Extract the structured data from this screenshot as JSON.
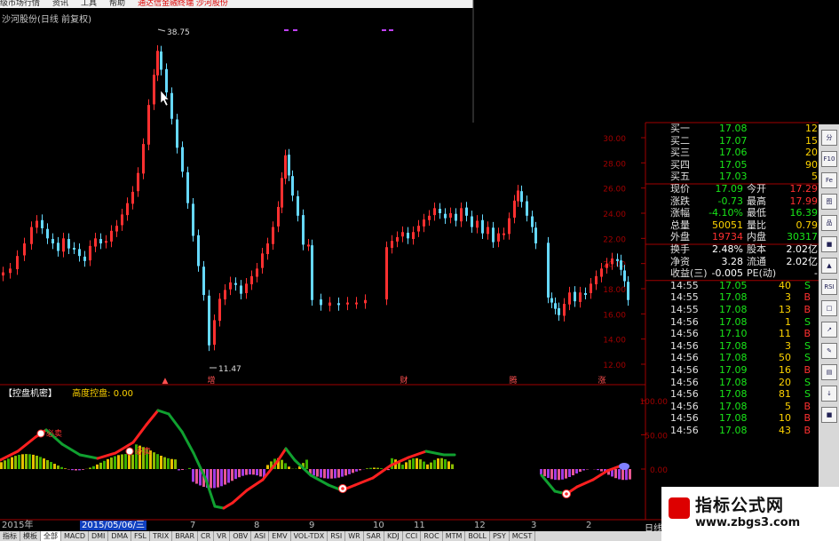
{
  "window": {
    "menu_items": [
      "级市场行情",
      "资讯",
      "工具",
      "帮助"
    ],
    "menu_highlight": "通达信金融终端  沙河股份",
    "stock_title": "沙河股份(日线 前复权)"
  },
  "main_chart": {
    "high_label": "38.75",
    "low_label": "11.47",
    "y_ticks": [
      "30.00",
      "28.00",
      "26.00",
      "24.00",
      "22.00",
      "20.00",
      "18.00",
      "16.00",
      "14.00",
      "12.00"
    ],
    "markers": [
      "▲",
      "增",
      "财",
      "腾",
      "涨"
    ]
  },
  "indicator": {
    "name": "【控盘机密】",
    "value_text": "高度控盘: 0.00",
    "y_ticks": [
      "100.00",
      "50.00",
      "0.00"
    ],
    "sell_labels": [
      "必卖",
      "必卖"
    ]
  },
  "dates": {
    "year": "2015年",
    "cursor_date": "2015/05/06/三",
    "months": [
      "7",
      "8",
      "9",
      "10",
      "11",
      "12",
      "3",
      "2"
    ],
    "period": "日线"
  },
  "tabs": {
    "left": [
      "指标",
      "模板"
    ],
    "items": [
      "全部",
      "MACD",
      "DMI",
      "DMA",
      "FSL",
      "TRIX",
      "BRAR",
      "CR",
      "VR",
      "OBV",
      "ASI",
      "EMV",
      "VOL-TDX",
      "RSI",
      "WR",
      "SAR",
      "KDJ",
      "CCI",
      "ROC",
      "MTM",
      "BOLL",
      "PSY",
      "MCST"
    ]
  },
  "quote": {
    "book": [
      {
        "label": "买一",
        "price": "17.08",
        "vol": "12"
      },
      {
        "label": "买二",
        "price": "17.07",
        "vol": "15"
      },
      {
        "label": "买三",
        "price": "17.06",
        "vol": "20"
      },
      {
        "label": "买四",
        "price": "17.05",
        "vol": "90"
      },
      {
        "label": "买五",
        "price": "17.03",
        "vol": "5"
      }
    ],
    "stats": [
      {
        "l1": "现价",
        "v1": "17.09",
        "c1": "green",
        "l2": "今开",
        "v2": "17.29",
        "c2": "red"
      },
      {
        "l1": "涨跌",
        "v1": "-0.73",
        "c1": "green",
        "l2": "最高",
        "v2": "17.99",
        "c2": "red"
      },
      {
        "l1": "涨幅",
        "v1": "-4.10%",
        "c1": "green",
        "l2": "最低",
        "v2": "16.39",
        "c2": "green"
      },
      {
        "l1": "总量",
        "v1": "50051",
        "c1": "yellow",
        "l2": "量比",
        "v2": "0.79",
        "c2": "yellow"
      },
      {
        "l1": "外盘",
        "v1": "19734",
        "c1": "red",
        "l2": "内盘",
        "v2": "30317",
        "c2": "green"
      }
    ],
    "fund": [
      {
        "l1": "换手",
        "v1": "2.48%",
        "l2": "股本",
        "v2": "2.02亿"
      },
      {
        "l1": "净资",
        "v1": "3.28",
        "l2": "流通",
        "v2": "2.02亿"
      },
      {
        "l1": "收益(三)",
        "v1": "-0.005",
        "l2": "PE(动)",
        "v2": "-"
      }
    ],
    "ticks": [
      {
        "time": "14:55",
        "price": "17.05",
        "vol": "40",
        "side": "S"
      },
      {
        "time": "14:55",
        "price": "17.08",
        "vol": "3",
        "side": "B"
      },
      {
        "time": "14:55",
        "price": "17.08",
        "vol": "13",
        "side": "B"
      },
      {
        "time": "14:56",
        "price": "17.08",
        "vol": "1",
        "side": "S"
      },
      {
        "time": "14:56",
        "price": "17.10",
        "vol": "11",
        "side": "B"
      },
      {
        "time": "14:56",
        "price": "17.08",
        "vol": "3",
        "side": "S"
      },
      {
        "time": "14:56",
        "price": "17.08",
        "vol": "50",
        "side": "S"
      },
      {
        "time": "14:56",
        "price": "17.09",
        "vol": "16",
        "side": "B"
      },
      {
        "time": "14:56",
        "price": "17.08",
        "vol": "20",
        "side": "S"
      },
      {
        "time": "14:56",
        "price": "17.08",
        "vol": "81",
        "side": "S"
      },
      {
        "time": "14:56",
        "price": "17.08",
        "vol": "5",
        "side": "B"
      },
      {
        "time": "14:56",
        "price": "17.08",
        "vol": "10",
        "side": "B"
      },
      {
        "time": "14:56",
        "price": "17.08",
        "vol": "43",
        "side": "B"
      }
    ]
  },
  "toolstrip": [
    "分",
    "F10",
    "Fe",
    "图",
    "品",
    "■",
    "▲",
    "RSI",
    "□",
    "↗",
    "✎",
    "▤",
    "↓",
    "■"
  ],
  "watermark": {
    "title": "指标公式网",
    "url": "www.zbgs3.com"
  },
  "colors": {
    "up": "#ff3030",
    "down": "#66d9ff",
    "flat": "#ffffff",
    "axis": "#a00000",
    "bg": "#000000"
  }
}
